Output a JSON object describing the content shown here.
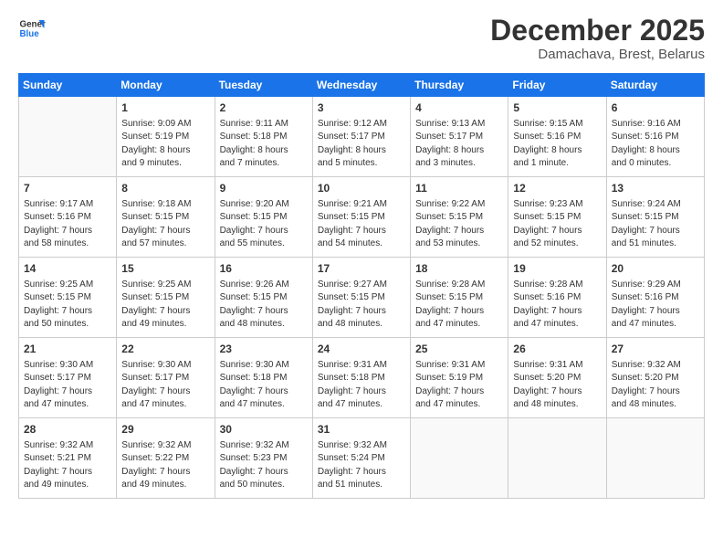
{
  "logo": {
    "line1": "General",
    "line2": "Blue"
  },
  "title": "December 2025",
  "location": "Damachava, Brest, Belarus",
  "header_days": [
    "Sunday",
    "Monday",
    "Tuesday",
    "Wednesday",
    "Thursday",
    "Friday",
    "Saturday"
  ],
  "weeks": [
    [
      {
        "day": "",
        "info": ""
      },
      {
        "day": "1",
        "info": "Sunrise: 9:09 AM\nSunset: 5:19 PM\nDaylight: 8 hours\nand 9 minutes."
      },
      {
        "day": "2",
        "info": "Sunrise: 9:11 AM\nSunset: 5:18 PM\nDaylight: 8 hours\nand 7 minutes."
      },
      {
        "day": "3",
        "info": "Sunrise: 9:12 AM\nSunset: 5:17 PM\nDaylight: 8 hours\nand 5 minutes."
      },
      {
        "day": "4",
        "info": "Sunrise: 9:13 AM\nSunset: 5:17 PM\nDaylight: 8 hours\nand 3 minutes."
      },
      {
        "day": "5",
        "info": "Sunrise: 9:15 AM\nSunset: 5:16 PM\nDaylight: 8 hours\nand 1 minute."
      },
      {
        "day": "6",
        "info": "Sunrise: 9:16 AM\nSunset: 5:16 PM\nDaylight: 8 hours\nand 0 minutes."
      }
    ],
    [
      {
        "day": "7",
        "info": "Sunrise: 9:17 AM\nSunset: 5:16 PM\nDaylight: 7 hours\nand 58 minutes."
      },
      {
        "day": "8",
        "info": "Sunrise: 9:18 AM\nSunset: 5:15 PM\nDaylight: 7 hours\nand 57 minutes."
      },
      {
        "day": "9",
        "info": "Sunrise: 9:20 AM\nSunset: 5:15 PM\nDaylight: 7 hours\nand 55 minutes."
      },
      {
        "day": "10",
        "info": "Sunrise: 9:21 AM\nSunset: 5:15 PM\nDaylight: 7 hours\nand 54 minutes."
      },
      {
        "day": "11",
        "info": "Sunrise: 9:22 AM\nSunset: 5:15 PM\nDaylight: 7 hours\nand 53 minutes."
      },
      {
        "day": "12",
        "info": "Sunrise: 9:23 AM\nSunset: 5:15 PM\nDaylight: 7 hours\nand 52 minutes."
      },
      {
        "day": "13",
        "info": "Sunrise: 9:24 AM\nSunset: 5:15 PM\nDaylight: 7 hours\nand 51 minutes."
      }
    ],
    [
      {
        "day": "14",
        "info": "Sunrise: 9:25 AM\nSunset: 5:15 PM\nDaylight: 7 hours\nand 50 minutes."
      },
      {
        "day": "15",
        "info": "Sunrise: 9:25 AM\nSunset: 5:15 PM\nDaylight: 7 hours\nand 49 minutes."
      },
      {
        "day": "16",
        "info": "Sunrise: 9:26 AM\nSunset: 5:15 PM\nDaylight: 7 hours\nand 48 minutes."
      },
      {
        "day": "17",
        "info": "Sunrise: 9:27 AM\nSunset: 5:15 PM\nDaylight: 7 hours\nand 48 minutes."
      },
      {
        "day": "18",
        "info": "Sunrise: 9:28 AM\nSunset: 5:15 PM\nDaylight: 7 hours\nand 47 minutes."
      },
      {
        "day": "19",
        "info": "Sunrise: 9:28 AM\nSunset: 5:16 PM\nDaylight: 7 hours\nand 47 minutes."
      },
      {
        "day": "20",
        "info": "Sunrise: 9:29 AM\nSunset: 5:16 PM\nDaylight: 7 hours\nand 47 minutes."
      }
    ],
    [
      {
        "day": "21",
        "info": "Sunrise: 9:30 AM\nSunset: 5:17 PM\nDaylight: 7 hours\nand 47 minutes."
      },
      {
        "day": "22",
        "info": "Sunrise: 9:30 AM\nSunset: 5:17 PM\nDaylight: 7 hours\nand 47 minutes."
      },
      {
        "day": "23",
        "info": "Sunrise: 9:30 AM\nSunset: 5:18 PM\nDaylight: 7 hours\nand 47 minutes."
      },
      {
        "day": "24",
        "info": "Sunrise: 9:31 AM\nSunset: 5:18 PM\nDaylight: 7 hours\nand 47 minutes."
      },
      {
        "day": "25",
        "info": "Sunrise: 9:31 AM\nSunset: 5:19 PM\nDaylight: 7 hours\nand 47 minutes."
      },
      {
        "day": "26",
        "info": "Sunrise: 9:31 AM\nSunset: 5:20 PM\nDaylight: 7 hours\nand 48 minutes."
      },
      {
        "day": "27",
        "info": "Sunrise: 9:32 AM\nSunset: 5:20 PM\nDaylight: 7 hours\nand 48 minutes."
      }
    ],
    [
      {
        "day": "28",
        "info": "Sunrise: 9:32 AM\nSunset: 5:21 PM\nDaylight: 7 hours\nand 49 minutes."
      },
      {
        "day": "29",
        "info": "Sunrise: 9:32 AM\nSunset: 5:22 PM\nDaylight: 7 hours\nand 49 minutes."
      },
      {
        "day": "30",
        "info": "Sunrise: 9:32 AM\nSunset: 5:23 PM\nDaylight: 7 hours\nand 50 minutes."
      },
      {
        "day": "31",
        "info": "Sunrise: 9:32 AM\nSunset: 5:24 PM\nDaylight: 7 hours\nand 51 minutes."
      },
      {
        "day": "",
        "info": ""
      },
      {
        "day": "",
        "info": ""
      },
      {
        "day": "",
        "info": ""
      }
    ]
  ]
}
